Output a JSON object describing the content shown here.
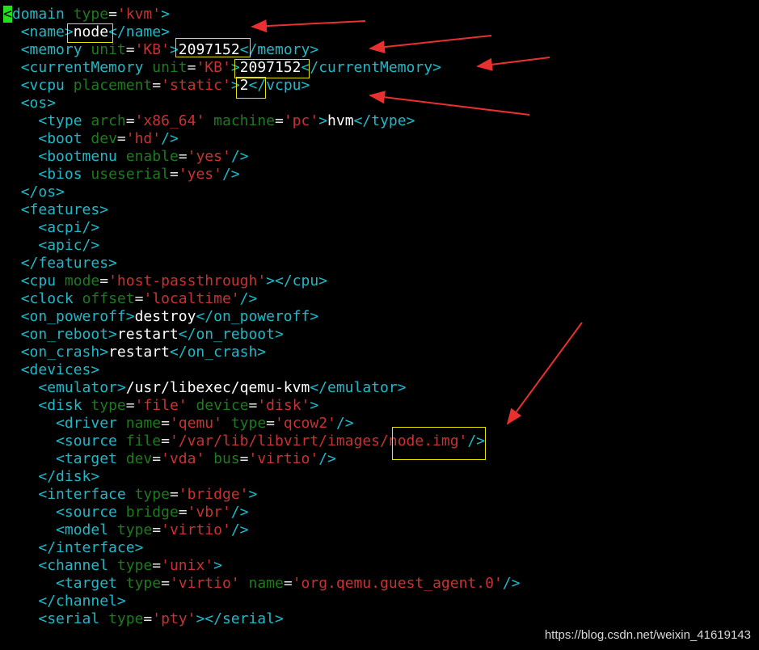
{
  "terminal": {
    "lines": [
      {
        "indent": 0,
        "tokens": [
          {
            "t": "<",
            "c": "cursor"
          },
          {
            "t": "domain",
            "c": "tag"
          },
          {
            "t": " "
          },
          {
            "t": "type",
            "c": "attr"
          },
          {
            "t": "=",
            "c": "eq"
          },
          {
            "t": "'kvm'",
            "c": "val"
          },
          {
            "t": ">",
            "c": "bracket"
          }
        ]
      },
      {
        "indent": 2,
        "tokens": [
          {
            "t": "<name>",
            "c": "tag"
          },
          {
            "t": "node",
            "c": "text"
          },
          {
            "t": "</name>",
            "c": "tag"
          }
        ]
      },
      {
        "indent": 2,
        "tokens": [
          {
            "t": "<memory",
            "c": "tag"
          },
          {
            "t": " "
          },
          {
            "t": "unit",
            "c": "attr"
          },
          {
            "t": "=",
            "c": "eq"
          },
          {
            "t": "'KB'",
            "c": "val"
          },
          {
            "t": ">",
            "c": "bracket"
          },
          {
            "t": "2097152",
            "c": "text"
          },
          {
            "t": "</memory>",
            "c": "tag"
          }
        ]
      },
      {
        "indent": 2,
        "tokens": [
          {
            "t": "<currentMemory",
            "c": "tag"
          },
          {
            "t": " "
          },
          {
            "t": "unit",
            "c": "attr"
          },
          {
            "t": "=",
            "c": "eq"
          },
          {
            "t": "'KB'",
            "c": "val"
          },
          {
            "t": ">",
            "c": "bracket"
          },
          {
            "t": "2097152",
            "c": "text"
          },
          {
            "t": "</currentMemory>",
            "c": "tag"
          }
        ]
      },
      {
        "indent": 2,
        "tokens": [
          {
            "t": "<vcpu",
            "c": "tag"
          },
          {
            "t": " "
          },
          {
            "t": "placement",
            "c": "attr"
          },
          {
            "t": "=",
            "c": "eq"
          },
          {
            "t": "'static'",
            "c": "val"
          },
          {
            "t": ">",
            "c": "bracket"
          },
          {
            "t": "2",
            "c": "text"
          },
          {
            "t": "</vcpu>",
            "c": "tag"
          }
        ]
      },
      {
        "indent": 2,
        "tokens": [
          {
            "t": "<os>",
            "c": "tag"
          }
        ]
      },
      {
        "indent": 4,
        "tokens": [
          {
            "t": "<type",
            "c": "tag"
          },
          {
            "t": " "
          },
          {
            "t": "arch",
            "c": "attr"
          },
          {
            "t": "=",
            "c": "eq"
          },
          {
            "t": "'x86_64'",
            "c": "val"
          },
          {
            "t": " "
          },
          {
            "t": "machine",
            "c": "attr"
          },
          {
            "t": "=",
            "c": "eq"
          },
          {
            "t": "'pc'",
            "c": "val"
          },
          {
            "t": ">",
            "c": "bracket"
          },
          {
            "t": "hvm",
            "c": "text"
          },
          {
            "t": "</type>",
            "c": "tag"
          }
        ]
      },
      {
        "indent": 4,
        "tokens": [
          {
            "t": "<boot",
            "c": "tag"
          },
          {
            "t": " "
          },
          {
            "t": "dev",
            "c": "attr"
          },
          {
            "t": "=",
            "c": "eq"
          },
          {
            "t": "'hd'",
            "c": "val"
          },
          {
            "t": "/>",
            "c": "bracket"
          }
        ]
      },
      {
        "indent": 4,
        "tokens": [
          {
            "t": "<bootmenu",
            "c": "tag"
          },
          {
            "t": " "
          },
          {
            "t": "enable",
            "c": "attr"
          },
          {
            "t": "=",
            "c": "eq"
          },
          {
            "t": "'yes'",
            "c": "val"
          },
          {
            "t": "/>",
            "c": "bracket"
          }
        ]
      },
      {
        "indent": 4,
        "tokens": [
          {
            "t": "<bios",
            "c": "tag"
          },
          {
            "t": " "
          },
          {
            "t": "useserial",
            "c": "attr"
          },
          {
            "t": "=",
            "c": "eq"
          },
          {
            "t": "'yes'",
            "c": "val"
          },
          {
            "t": "/>",
            "c": "bracket"
          }
        ]
      },
      {
        "indent": 2,
        "tokens": [
          {
            "t": "</os>",
            "c": "tag"
          }
        ]
      },
      {
        "indent": 2,
        "tokens": [
          {
            "t": "<features>",
            "c": "tag"
          }
        ]
      },
      {
        "indent": 4,
        "tokens": [
          {
            "t": "<acpi/>",
            "c": "tag"
          }
        ]
      },
      {
        "indent": 4,
        "tokens": [
          {
            "t": "<apic/>",
            "c": "tag"
          }
        ]
      },
      {
        "indent": 2,
        "tokens": [
          {
            "t": "</features>",
            "c": "tag"
          }
        ]
      },
      {
        "indent": 2,
        "tokens": [
          {
            "t": "<cpu",
            "c": "tag"
          },
          {
            "t": " "
          },
          {
            "t": "mode",
            "c": "attr"
          },
          {
            "t": "=",
            "c": "eq"
          },
          {
            "t": "'host-passthrough'",
            "c": "val"
          },
          {
            "t": "></cpu>",
            "c": "tag"
          }
        ]
      },
      {
        "indent": 2,
        "tokens": [
          {
            "t": "<clock",
            "c": "tag"
          },
          {
            "t": " "
          },
          {
            "t": "offset",
            "c": "attr"
          },
          {
            "t": "=",
            "c": "eq"
          },
          {
            "t": "'localtime'",
            "c": "val"
          },
          {
            "t": "/>",
            "c": "bracket"
          }
        ]
      },
      {
        "indent": 2,
        "tokens": [
          {
            "t": "<on_poweroff>",
            "c": "tag"
          },
          {
            "t": "destroy",
            "c": "text"
          },
          {
            "t": "</on_poweroff>",
            "c": "tag"
          }
        ]
      },
      {
        "indent": 2,
        "tokens": [
          {
            "t": "<on_reboot>",
            "c": "tag"
          },
          {
            "t": "restart",
            "c": "text"
          },
          {
            "t": "</on_reboot>",
            "c": "tag"
          }
        ]
      },
      {
        "indent": 2,
        "tokens": [
          {
            "t": "<on_crash>",
            "c": "tag"
          },
          {
            "t": "restart",
            "c": "text"
          },
          {
            "t": "</on_crash>",
            "c": "tag"
          }
        ]
      },
      {
        "indent": 2,
        "tokens": [
          {
            "t": "<devices>",
            "c": "tag"
          }
        ]
      },
      {
        "indent": 4,
        "tokens": [
          {
            "t": "<emulator>",
            "c": "tag"
          },
          {
            "t": "/usr/libexec/qemu-kvm",
            "c": "text"
          },
          {
            "t": "</emulator>",
            "c": "tag"
          }
        ]
      },
      {
        "indent": 4,
        "tokens": [
          {
            "t": "<disk",
            "c": "tag"
          },
          {
            "t": " "
          },
          {
            "t": "type",
            "c": "attr"
          },
          {
            "t": "=",
            "c": "eq"
          },
          {
            "t": "'file'",
            "c": "val"
          },
          {
            "t": " "
          },
          {
            "t": "device",
            "c": "attr"
          },
          {
            "t": "=",
            "c": "eq"
          },
          {
            "t": "'disk'",
            "c": "val"
          },
          {
            "t": ">",
            "c": "bracket"
          }
        ]
      },
      {
        "indent": 6,
        "tokens": [
          {
            "t": "<driver",
            "c": "tag"
          },
          {
            "t": " "
          },
          {
            "t": "name",
            "c": "attr"
          },
          {
            "t": "=",
            "c": "eq"
          },
          {
            "t": "'qemu'",
            "c": "val"
          },
          {
            "t": " "
          },
          {
            "t": "type",
            "c": "attr"
          },
          {
            "t": "=",
            "c": "eq"
          },
          {
            "t": "'qcow2'",
            "c": "val"
          },
          {
            "t": "/>",
            "c": "bracket"
          }
        ]
      },
      {
        "indent": 6,
        "tokens": [
          {
            "t": "<source",
            "c": "tag"
          },
          {
            "t": " "
          },
          {
            "t": "file",
            "c": "attr"
          },
          {
            "t": "=",
            "c": "eq"
          },
          {
            "t": "'/var/lib/libvirt/images/node.img'",
            "c": "val"
          },
          {
            "t": "/>",
            "c": "bracket"
          }
        ]
      },
      {
        "indent": 6,
        "tokens": [
          {
            "t": "<target",
            "c": "tag"
          },
          {
            "t": " "
          },
          {
            "t": "dev",
            "c": "attr"
          },
          {
            "t": "=",
            "c": "eq"
          },
          {
            "t": "'vda'",
            "c": "val"
          },
          {
            "t": " "
          },
          {
            "t": "bus",
            "c": "attr"
          },
          {
            "t": "=",
            "c": "eq"
          },
          {
            "t": "'virtio'",
            "c": "val"
          },
          {
            "t": "/>",
            "c": "bracket"
          }
        ]
      },
      {
        "indent": 4,
        "tokens": [
          {
            "t": "</disk>",
            "c": "tag"
          }
        ]
      },
      {
        "indent": 4,
        "tokens": [
          {
            "t": "<interface",
            "c": "tag"
          },
          {
            "t": " "
          },
          {
            "t": "type",
            "c": "attr"
          },
          {
            "t": "=",
            "c": "eq"
          },
          {
            "t": "'bridge'",
            "c": "val"
          },
          {
            "t": ">",
            "c": "bracket"
          }
        ]
      },
      {
        "indent": 6,
        "tokens": [
          {
            "t": "<source",
            "c": "tag"
          },
          {
            "t": " "
          },
          {
            "t": "bridge",
            "c": "attr"
          },
          {
            "t": "=",
            "c": "eq"
          },
          {
            "t": "'vbr'",
            "c": "val"
          },
          {
            "t": "/>",
            "c": "bracket"
          }
        ]
      },
      {
        "indent": 6,
        "tokens": [
          {
            "t": "<model",
            "c": "tag"
          },
          {
            "t": " "
          },
          {
            "t": "type",
            "c": "attr"
          },
          {
            "t": "=",
            "c": "eq"
          },
          {
            "t": "'virtio'",
            "c": "val"
          },
          {
            "t": "/>",
            "c": "bracket"
          }
        ]
      },
      {
        "indent": 4,
        "tokens": [
          {
            "t": "</interface>",
            "c": "tag"
          }
        ]
      },
      {
        "indent": 4,
        "tokens": [
          {
            "t": "<channel",
            "c": "tag"
          },
          {
            "t": " "
          },
          {
            "t": "type",
            "c": "attr"
          },
          {
            "t": "=",
            "c": "eq"
          },
          {
            "t": "'unix'",
            "c": "val"
          },
          {
            "t": ">",
            "c": "bracket"
          }
        ]
      },
      {
        "indent": 6,
        "tokens": [
          {
            "t": "<target",
            "c": "tag"
          },
          {
            "t": " "
          },
          {
            "t": "type",
            "c": "attr"
          },
          {
            "t": "=",
            "c": "eq"
          },
          {
            "t": "'virtio'",
            "c": "val"
          },
          {
            "t": " "
          },
          {
            "t": "name",
            "c": "attr"
          },
          {
            "t": "=",
            "c": "eq"
          },
          {
            "t": "'org.qemu.guest_agent.0'",
            "c": "val"
          },
          {
            "t": "/>",
            "c": "bracket"
          }
        ]
      },
      {
        "indent": 4,
        "tokens": [
          {
            "t": "</channel>",
            "c": "tag"
          }
        ]
      },
      {
        "indent": 4,
        "tokens": [
          {
            "t": "<serial",
            "c": "tag"
          },
          {
            "t": " "
          },
          {
            "t": "type",
            "c": "attr"
          },
          {
            "t": "=",
            "c": "eq"
          },
          {
            "t": "'pty'",
            "c": "val"
          },
          {
            "t": "></serial>",
            "c": "tag"
          }
        ]
      }
    ]
  },
  "colors": {
    "background": "#000000",
    "tag": "#20b8c8",
    "attribute": "#1e7a1e",
    "value": "#c83232",
    "text": "#ffffff",
    "cursor": "#22e01e",
    "highlight_box": "#e8e400",
    "annotation_arrow": "#e83030"
  },
  "annotations": {
    "highlighted_values": [
      "node",
      "2097152",
      "2097152",
      "2",
      "node.img"
    ],
    "arrow_count": 5
  },
  "watermark": {
    "text": "https://blog.csdn.net/weixin_41619143"
  }
}
